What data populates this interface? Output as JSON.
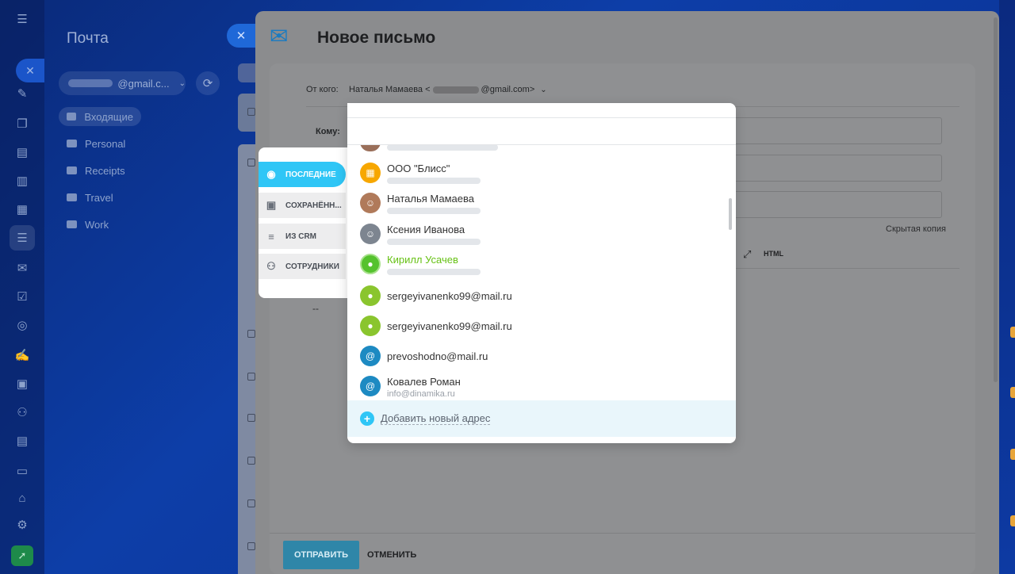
{
  "sidebar": {
    "title": "Почта",
    "account_suffix": "@gmail.c...",
    "folders": [
      {
        "label": "Входящие"
      },
      {
        "label": "Personal"
      },
      {
        "label": "Receipts"
      },
      {
        "label": "Travel"
      },
      {
        "label": "Work"
      }
    ]
  },
  "slider": {
    "title": "Новое письмо",
    "from_label": "От кого:",
    "from_name": "Наталья Мамаева <",
    "from_email_suffix": "@gmail.com>",
    "to_label": "Кому:",
    "bcc_link": "Скрытая копия",
    "html_label": "HTML",
    "body_text": "--",
    "send_label": "ОТПРАВИТЬ",
    "cancel_label": "ОТМЕНИТЬ"
  },
  "popup": {
    "tabs": [
      {
        "label": "ПОСЛЕДНИЕ",
        "icon": "search-list-icon",
        "active": true
      },
      {
        "label": "СОХРАНЁНН...",
        "icon": "address-book-icon",
        "active": false
      },
      {
        "label": "ИЗ CRM",
        "icon": "crm-filter-icon",
        "active": false
      },
      {
        "label": "СОТРУДНИКИ",
        "icon": "employees-icon",
        "active": false
      }
    ],
    "contacts": [
      {
        "name": "ООО \"Блисс\"",
        "sub": "",
        "avatar": "company-icon",
        "color": "#f7a700",
        "green": false
      },
      {
        "name": "Наталья Мамаева",
        "sub": "",
        "avatar": "photo",
        "color": "#b07a5a",
        "green": false
      },
      {
        "name": "Ксения Иванова",
        "sub": "",
        "avatar": "photo",
        "color": "#7d8590",
        "green": false
      },
      {
        "name": "Кирилл Усачев",
        "sub": "",
        "avatar": "user-icon",
        "color": "#55c22e",
        "green": true
      },
      {
        "name": "sergeyivanenko99@mail.ru",
        "sub": "",
        "avatar": "user-icon",
        "color": "#8ac52e",
        "green": false
      },
      {
        "name": "sergeyivanenko99@mail.ru",
        "sub": "",
        "avatar": "user-icon",
        "color": "#8ac52e",
        "green": false
      },
      {
        "name": "prevoshodno@mail.ru",
        "sub": "",
        "avatar": "at-icon",
        "color": "#1d8ac2",
        "green": false
      },
      {
        "name": "Ковалев Роман",
        "sub": "info@dinamika.ru",
        "avatar": "at-icon",
        "color": "#1d8ac2",
        "green": false
      }
    ],
    "add_label": "Добавить новый адрес"
  }
}
